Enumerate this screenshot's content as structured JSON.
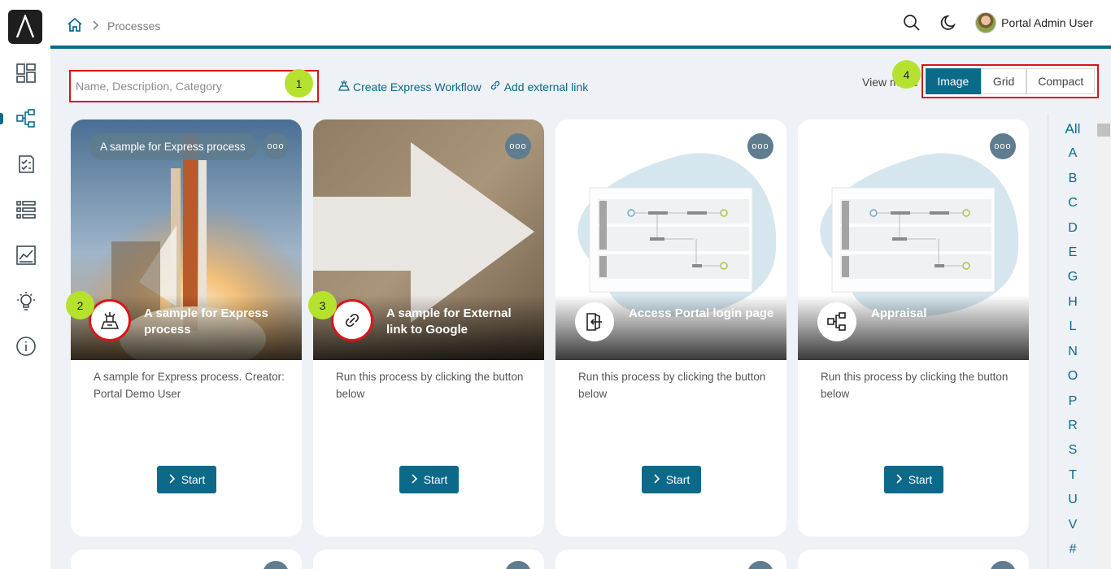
{
  "app": {
    "logo_icon": "axon-logo-icon"
  },
  "sidebar": {
    "items": [
      {
        "name": "dashboard",
        "icon": "dashboard-icon"
      },
      {
        "name": "processes",
        "icon": "process-icon",
        "active": true
      },
      {
        "name": "tasks",
        "icon": "task-checklist-icon"
      },
      {
        "name": "cases",
        "icon": "list-icon"
      },
      {
        "name": "statistics",
        "icon": "chart-icon"
      },
      {
        "name": "ideas",
        "icon": "lightbulb-icon"
      },
      {
        "name": "about",
        "icon": "info-icon"
      }
    ]
  },
  "header": {
    "breadcrumb": {
      "home_icon": "home-icon",
      "current": "Processes"
    },
    "user_name": "Portal Admin User"
  },
  "toolbar": {
    "search_placeholder": "Name, Description, Category",
    "create_express_label": "Create Express Workflow",
    "add_external_label": "Add external link",
    "view_mode_label": "View mode",
    "view_modes": [
      "Image",
      "Grid",
      "Compact"
    ],
    "active_view_mode": "Image"
  },
  "badges": [
    "1",
    "2",
    "3",
    "4"
  ],
  "cards": [
    {
      "title": "A sample for Express process",
      "description": "A sample for Express process. Creator: Portal Demo User",
      "chip": "A sample for Express process",
      "icon": "express-workflow-icon",
      "start_label": "Start"
    },
    {
      "title": "A sample for External link to Google",
      "description": "Run this process by clicking the button below",
      "icon": "link-icon",
      "start_label": "Start"
    },
    {
      "title": "Access Portal login page",
      "description": "Run this process by clicking the button below",
      "icon": "login-door-icon",
      "start_label": "Start"
    },
    {
      "title": "Appraisal",
      "description": "Run this process by clicking the button below",
      "icon": "process-icon",
      "start_label": "Start"
    }
  ],
  "more_label": "ooo",
  "alphabet": [
    "All",
    "A",
    "B",
    "C",
    "D",
    "E",
    "G",
    "H",
    "L",
    "N",
    "O",
    "P",
    "R",
    "S",
    "T",
    "U",
    "V",
    "#"
  ],
  "colors": {
    "accent": "#0b6a8a",
    "highlight_border": "#d8161b",
    "badge": "#b5e22e"
  }
}
